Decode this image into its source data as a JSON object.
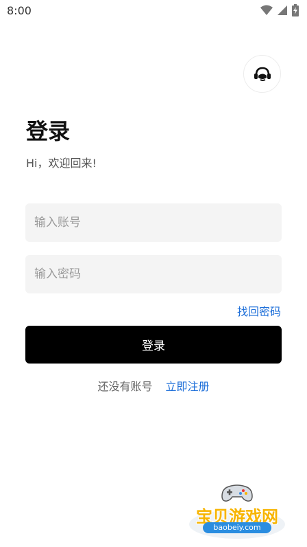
{
  "status_bar": {
    "time": "8:00"
  },
  "icons": {
    "wifi": "wifi-icon",
    "signal": "signal-icon",
    "battery": "battery-charging-icon",
    "support": "customer-service-icon"
  },
  "login": {
    "title": "登录",
    "subtitle": "Hi，欢迎回来!",
    "account_placeholder": "输入账号",
    "password_placeholder": "输入密码",
    "forgot_password": "找回密码",
    "submit": "登录",
    "no_account": "还没有账号",
    "register": "立即注册"
  },
  "watermark": {
    "text": "宝贝游戏网",
    "url": "baobeiy.com"
  },
  "colors": {
    "link": "#1e6fd9",
    "button": "#000000",
    "field_bg": "#f4f4f4",
    "watermark": "#f7b400"
  }
}
